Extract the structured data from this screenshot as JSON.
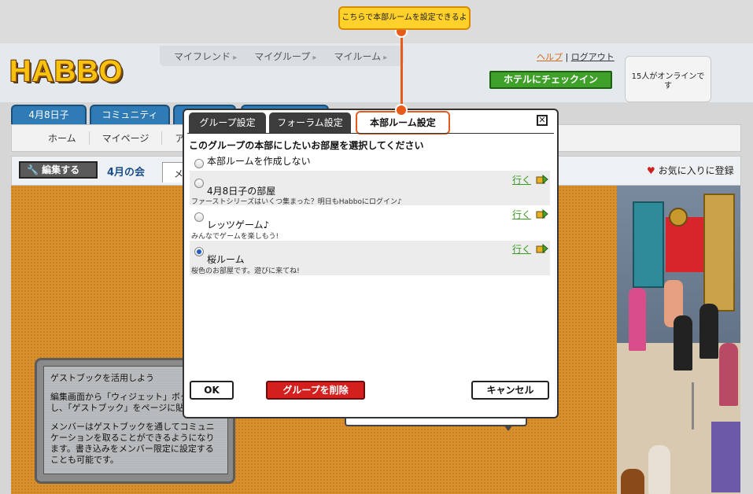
{
  "header": {
    "logo_text": "HABBO",
    "nav": [
      "マイフレンド",
      "マイグループ",
      "マイルーム"
    ],
    "help": "ヘルプ",
    "separator": "|",
    "logout": "ログアウト",
    "checkin": "ホテルにチェックイン",
    "online": "15人がオンラインです"
  },
  "tabs": [
    "4月8日子",
    "コミュニティ"
  ],
  "subnav": [
    "ホーム",
    "マイページ",
    "アカウ"
  ],
  "groupbar": {
    "edit": "編集する",
    "group_name": "4月の会",
    "tab_partial": "メ",
    "favorite": "お気に入りに登録",
    "heart": "♥"
  },
  "guestbook": {
    "title": "ゲストブックを活用しよう",
    "line1": "編集画面から「ウィジェット」ボタン",
    "line2": "し、「ゲストブック」をページに貼り",
    "line3": "メンバーはゲストブックを通してコミュニケーションを取ることができるようになります。書き込みをメンバー限定に設定することも可能です。"
  },
  "tooltip": "こちらで本部ルームを設定できるよ",
  "dialog": {
    "tabs": [
      "グループ設定",
      "フォーラム設定",
      "本部ルーム設定"
    ],
    "close": "✕",
    "title": "このグループの本部にしたいお部屋を選択してください",
    "options": [
      {
        "name": "本部ルームを作成しない",
        "desc": "",
        "go": "",
        "selected": false
      },
      {
        "name": "4月8日子の部屋",
        "desc": "ファーストシリーズはいくつ集まった？明日もHabboにログイン♪",
        "go": "行く",
        "selected": false
      },
      {
        "name": "レッツゲーム♪",
        "desc": "みんなでゲームを楽しもう!",
        "go": "行く",
        "selected": false
      },
      {
        "name": "桜ルーム",
        "desc": "桜色のお部屋です。遊びに来てね!",
        "go": "行く",
        "selected": true
      }
    ],
    "ok": "OK",
    "delete": "グループを削除",
    "cancel": "キャンセル"
  },
  "colors": {
    "accent_orange": "#e85a1a",
    "checkin_green": "#3fa02a",
    "delete_red": "#d41f1f",
    "tab_blue": "#2f7bb6"
  }
}
